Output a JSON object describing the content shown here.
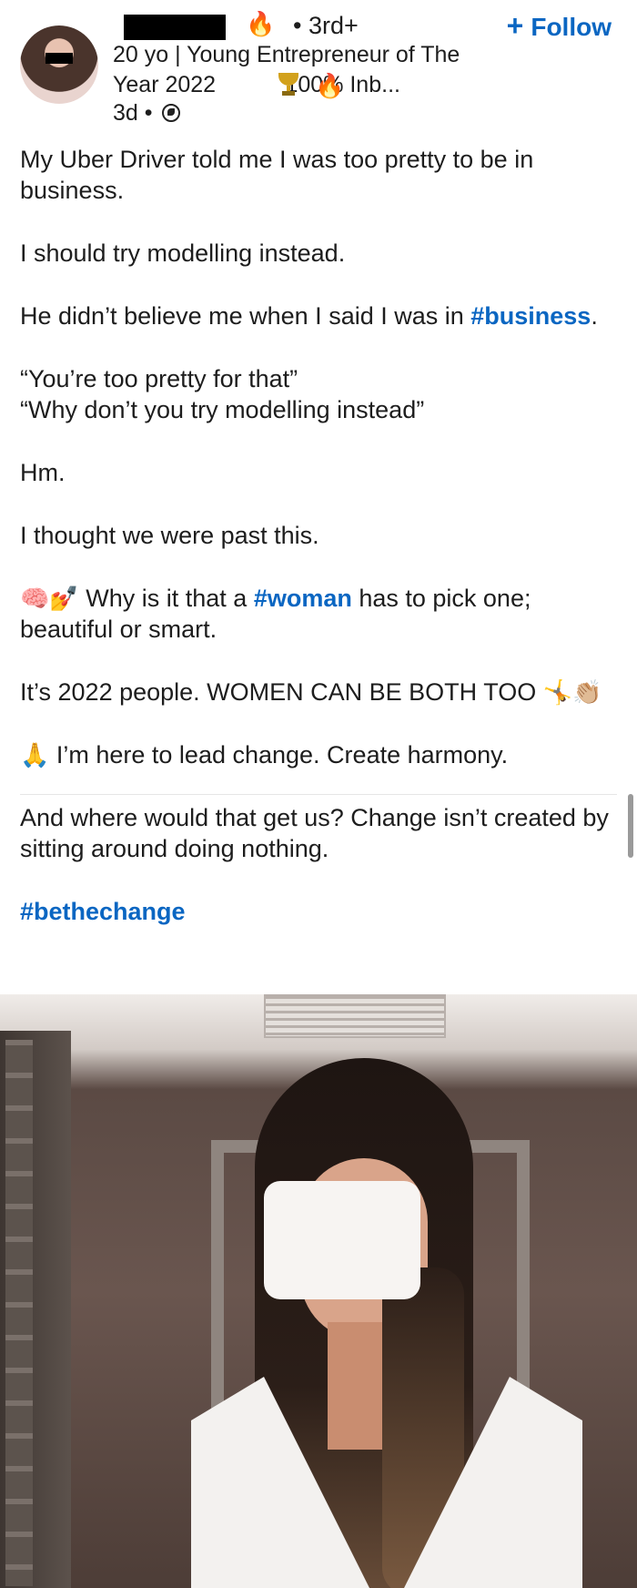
{
  "header": {
    "degree": "• 3rd+",
    "follow_label": "Follow",
    "follow_plus": "+",
    "headline": "20 yo | Young Entrepreneur of The Year 2022           100% Inb...",
    "fire_emoji": "🔥",
    "meta_time": "3d •",
    "icons": [
      "fire-icon",
      "trophy-icon",
      "globe-icon"
    ]
  },
  "post": {
    "p1": "My Uber Driver told me I was too pretty to be in business.",
    "p2": "I should try modelling instead.",
    "p3_pre": "He didn’t believe me when I said I was in ",
    "p3_tag": "#business",
    "p3_post": ".",
    "p4": "“You’re too pretty for that”\n“Why don’t you try modelling instead”",
    "p5": "Hm.",
    "p6": "I thought we were past this.",
    "p7_emoji": "🧠💅",
    "p7_pre": " Why is it that a ",
    "p7_tag": "#woman",
    "p7_post": " has to pick one; beautiful or smart.",
    "p8": "It’s 2022 people. WOMEN CAN BE BOTH TOO ",
    "p8_emoji": "🤸👏🏼",
    "p9_emoji": "🙏",
    "p9": " I’m here to lead change. Create harmony.",
    "p10": "And where would that get us? Change isn’t created by sitting around doing nothing.",
    "p11_tag": "#bethechange"
  },
  "colors": {
    "accent": "#0a66c2",
    "text": "#1d1d1d"
  }
}
